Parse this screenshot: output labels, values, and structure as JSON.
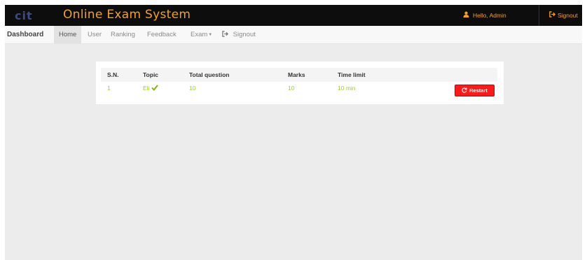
{
  "header": {
    "logo_text": "cit",
    "app_title": "Online Exam System",
    "hello_label": "Hello, Admin",
    "signout_label": "Signout"
  },
  "nav": {
    "brand": "Dashboard",
    "items": [
      {
        "label": "Home",
        "active": true
      },
      {
        "label": "User"
      },
      {
        "label": "Ranking"
      },
      {
        "label": "Feedback"
      },
      {
        "label": "Exam"
      },
      {
        "label": "Signout",
        "icon": "signout-icon"
      }
    ]
  },
  "table": {
    "headers": [
      "S.N.",
      "Topic",
      "Total question",
      "Marks",
      "Time limit"
    ],
    "rows": [
      {
        "sn": "1",
        "topic": "Eli",
        "topic_icon": "check-icon",
        "total_question": "10",
        "marks": "10",
        "time_limit": "10 min",
        "action_label": "Restart",
        "action_icon": "restart-icon"
      }
    ]
  },
  "colors": {
    "brand_orange": "#f5a11c",
    "row_text_green": "#9acd32",
    "restart_red": "#ff1a1a",
    "header_bg": "#0d0d0d"
  }
}
